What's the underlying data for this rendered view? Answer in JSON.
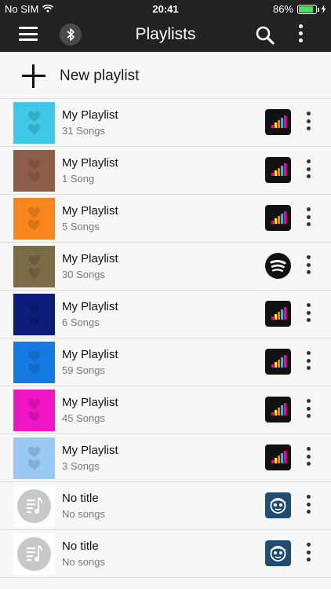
{
  "status": {
    "carrier": "No SIM",
    "time": "20:41",
    "battery_percent": "86%",
    "battery_level": 0.86
  },
  "navbar": {
    "title": "Playlists"
  },
  "new_playlist": {
    "label": "New playlist"
  },
  "playlists": [
    {
      "name": "My Playlist",
      "count": "31 Songs",
      "color": "#3cc8e6",
      "service": "deezer"
    },
    {
      "name": "My Playlist",
      "count": "1 Song",
      "color": "#8e5d49",
      "service": "deezer"
    },
    {
      "name": "My Playlist",
      "count": "5 Songs",
      "color": "#f9861c",
      "service": "deezer"
    },
    {
      "name": "My Playlist",
      "count": "30 Songs",
      "color": "#7d6a46",
      "service": "spotify"
    },
    {
      "name": "My Playlist",
      "count": "6 Songs",
      "color": "#0d1d7b",
      "service": "deezer"
    },
    {
      "name": "My Playlist",
      "count": "59 Songs",
      "color": "#1579e3",
      "service": "deezer"
    },
    {
      "name": "My Playlist",
      "count": "45 Songs",
      "color": "#f015c5",
      "service": "deezer"
    },
    {
      "name": "My Playlist",
      "count": "3 Songs",
      "color": "#98c8f3",
      "service": "deezer"
    },
    {
      "name": "No title",
      "count": "No songs",
      "color": "#c8c8c8",
      "service": "napster"
    },
    {
      "name": "No title",
      "count": "No songs",
      "color": "#c8c8c8",
      "service": "napster"
    }
  ]
}
